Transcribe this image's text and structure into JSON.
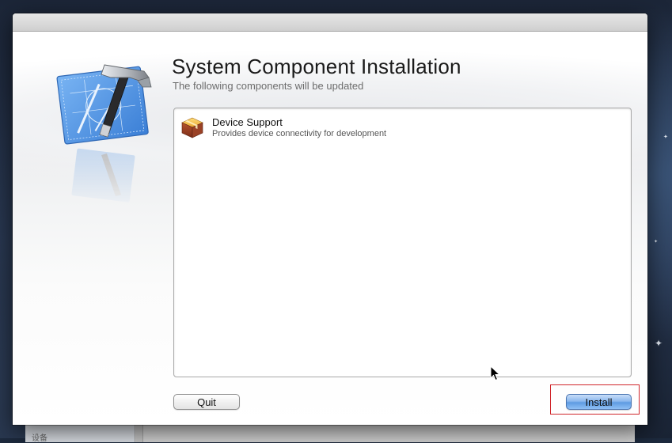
{
  "dialog": {
    "title": "System Component Installation",
    "subtitle": "The following components will be updated"
  },
  "components": [
    {
      "name": "Device Support",
      "description": "Provides device connectivity for development",
      "icon": "package-icon"
    }
  ],
  "buttons": {
    "quit_label": "Quit",
    "install_label": "Install"
  },
  "background_window": {
    "sidebar_text": "设备"
  },
  "icons": {
    "app": "xcode-hammer-blueprint-icon",
    "package": "package-icon",
    "cursor": "mouse-pointer-icon"
  },
  "colors": {
    "install_button": "#6aa4e8",
    "highlight_box": "#d0262b",
    "blueprint": "#4a90e2"
  }
}
